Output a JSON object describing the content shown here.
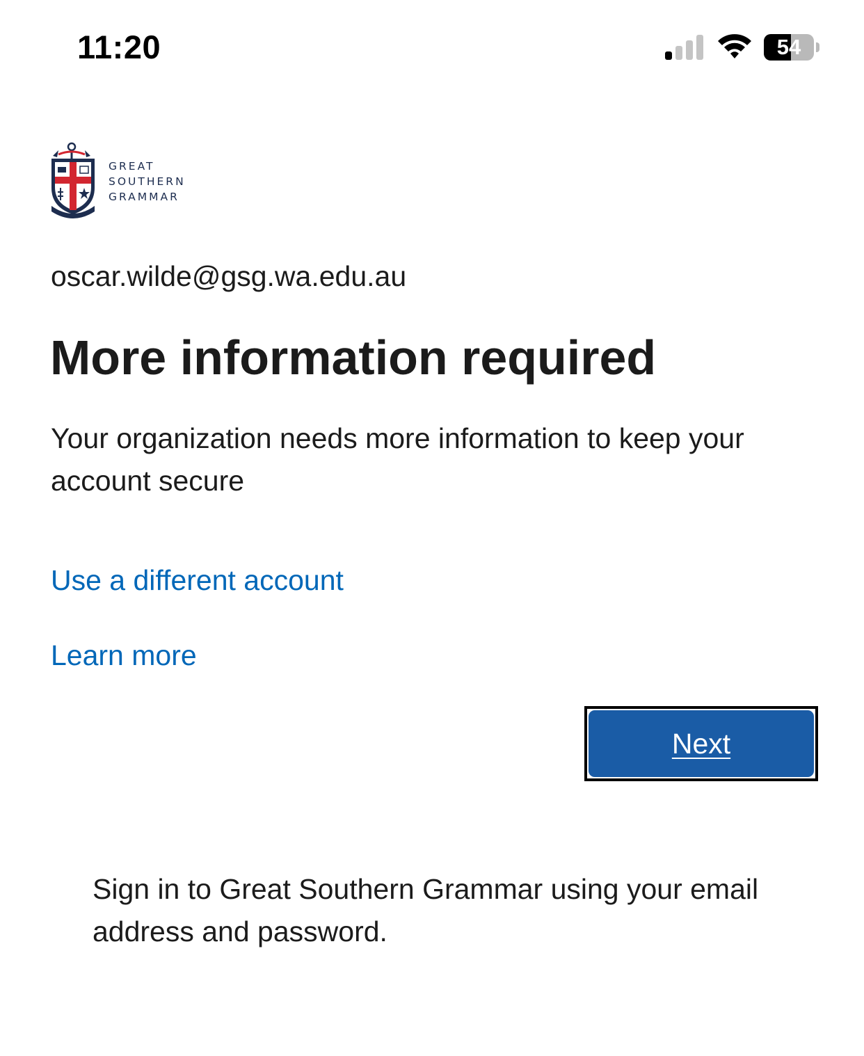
{
  "status_bar": {
    "time": "11:20",
    "signal_icon": "cellular-signal-icon",
    "signal_bars_active": 1,
    "signal_bars_total": 4,
    "wifi_icon": "wifi-icon",
    "battery_icon": "battery-icon",
    "battery_level": "54"
  },
  "logo": {
    "icon": "school-crest-icon",
    "lines": [
      "GREAT",
      "SOUTHERN",
      "GRAMMAR"
    ]
  },
  "account": {
    "email": "oscar.wilde@gsg.wa.edu.au"
  },
  "main": {
    "title": "More information required",
    "description": "Your organization needs more information to keep your account secure",
    "links": {
      "different_account": "Use a different account",
      "learn_more": "Learn more"
    },
    "next_label": "Next"
  },
  "footer": {
    "text": "Sign in to Great Southern Grammar using your email address and password."
  },
  "colors": {
    "link": "#0067b8",
    "button": "#1a5ca6",
    "text": "#1b1b1b",
    "crest_navy": "#1d2d4f",
    "crest_red": "#d22630"
  }
}
